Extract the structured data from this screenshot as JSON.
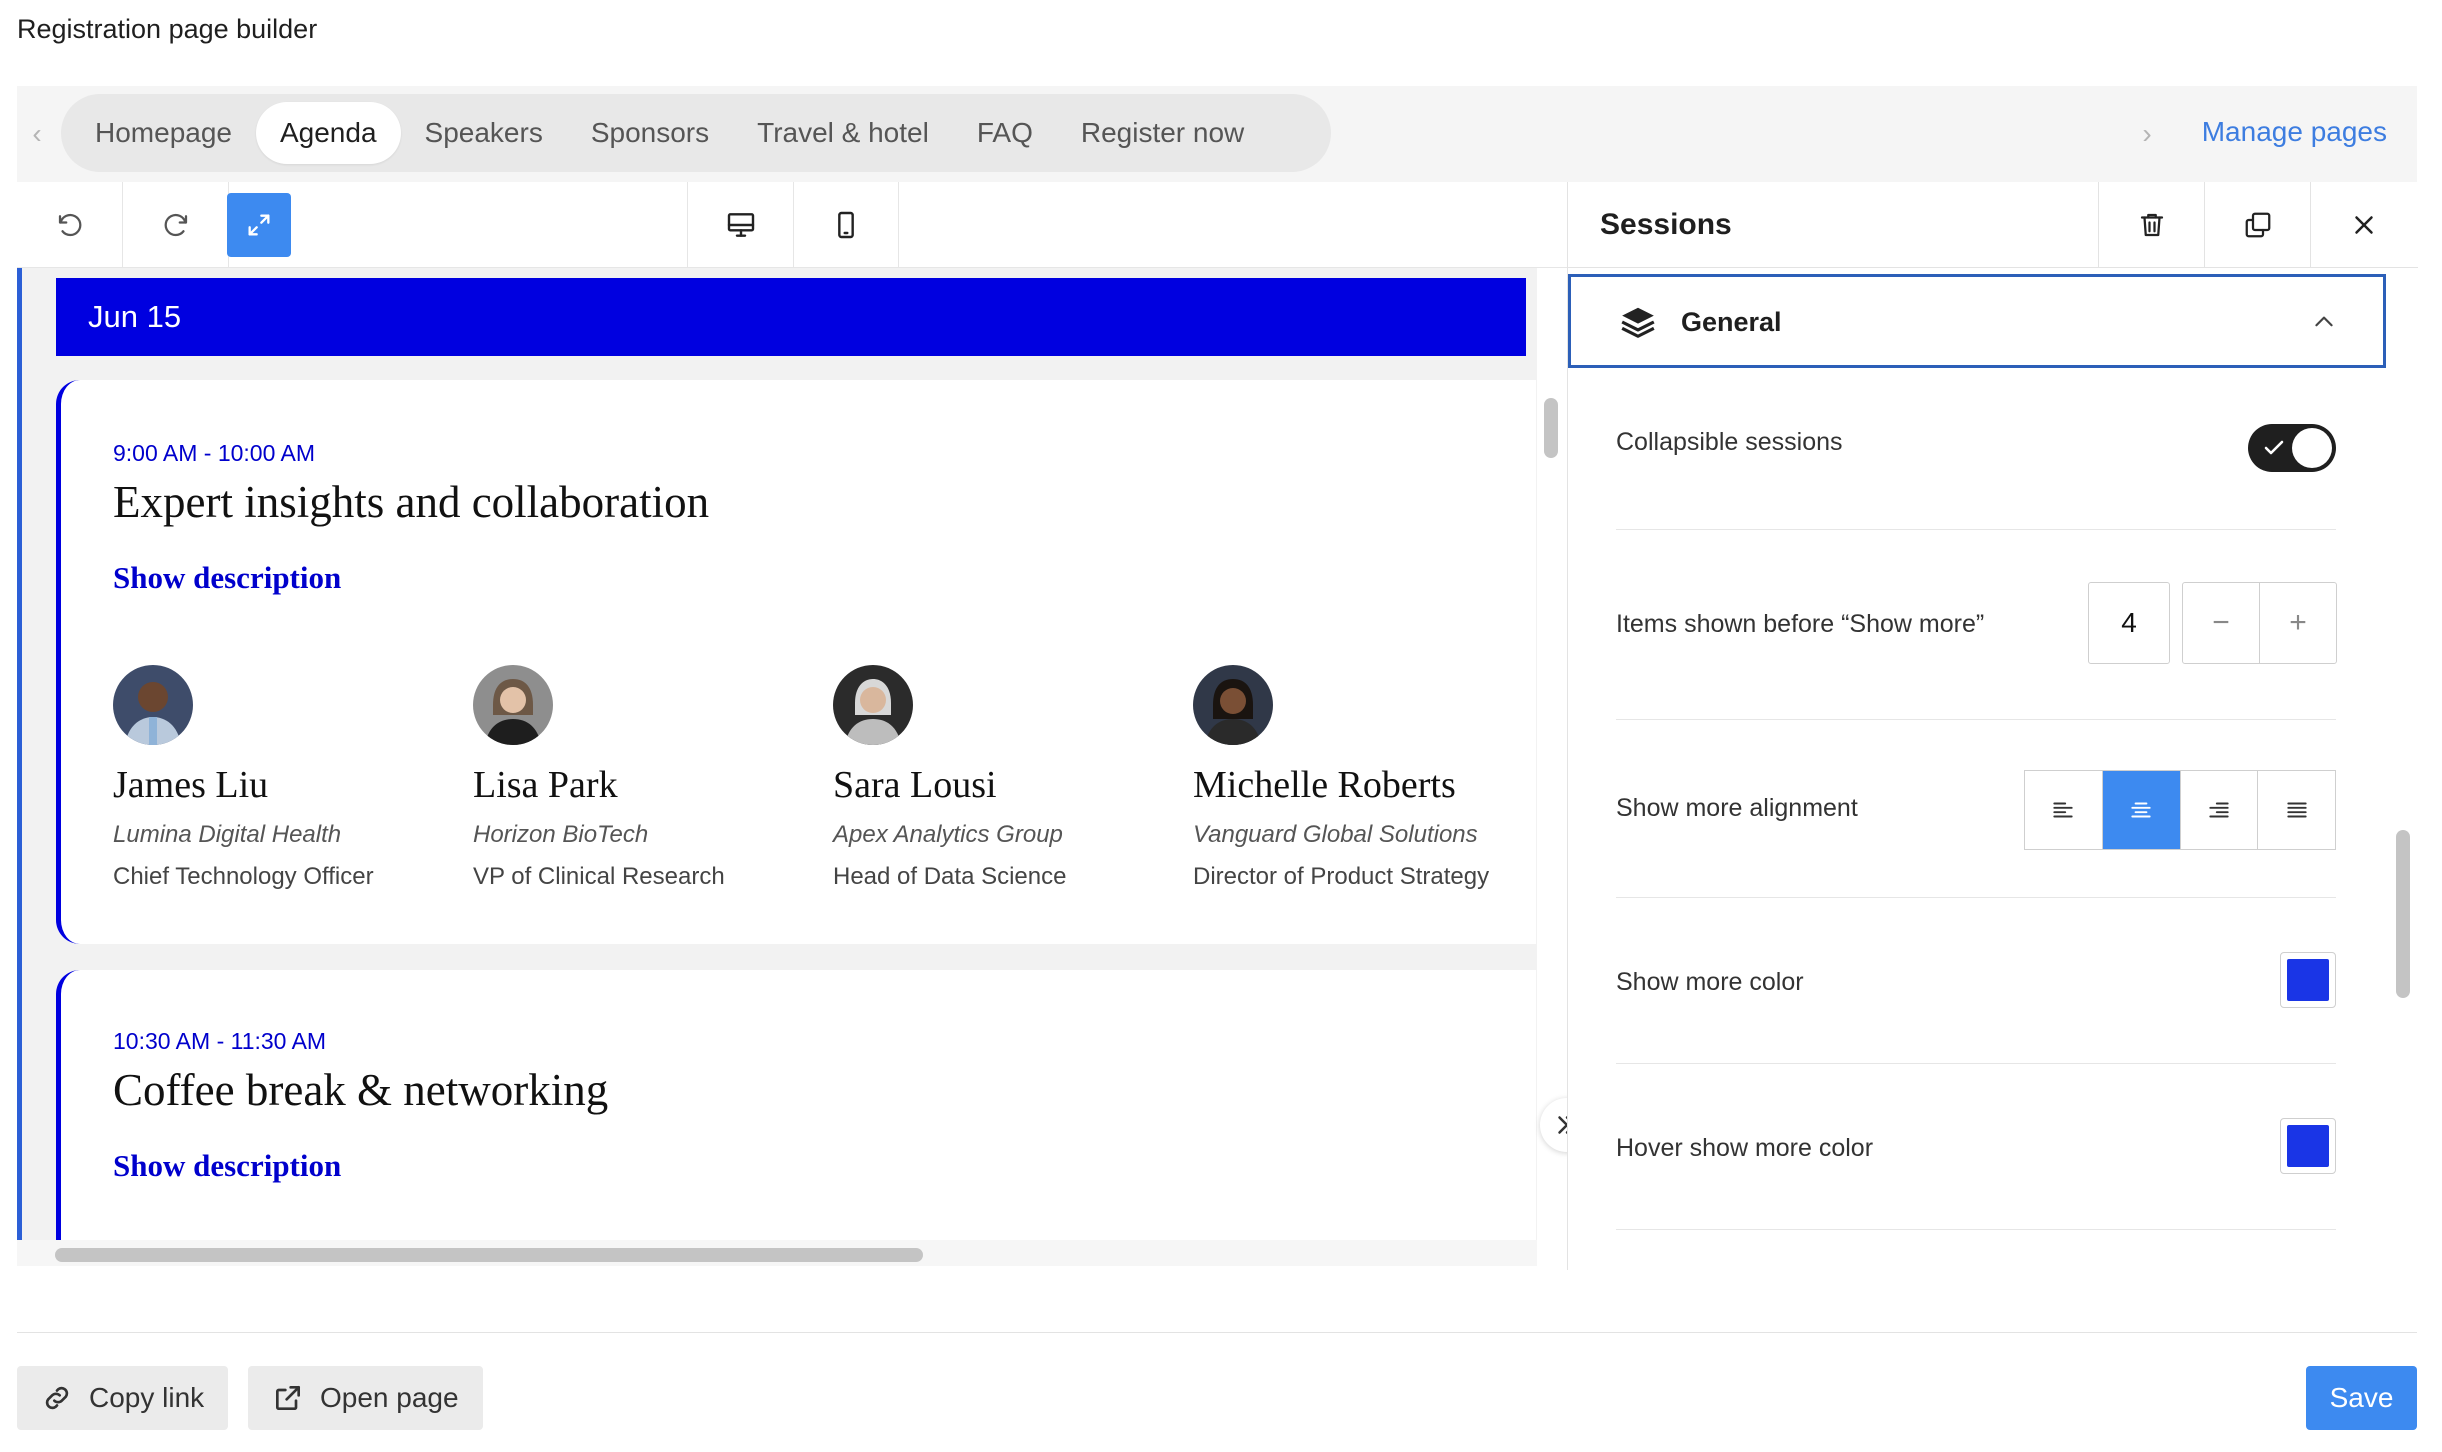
{
  "app": {
    "title": "Registration page builder"
  },
  "pages": {
    "tabs": [
      {
        "label": "Homepage"
      },
      {
        "label": "Agenda"
      },
      {
        "label": "Speakers"
      },
      {
        "label": "Sponsors"
      },
      {
        "label": "Travel & hotel"
      },
      {
        "label": "FAQ"
      },
      {
        "label": "Register now"
      }
    ],
    "active_tab": "Agenda",
    "manage_label": "Manage pages"
  },
  "agenda": {
    "date": "Jun 15",
    "accent_color": "#0000e0",
    "sessions": [
      {
        "time": "9:00 AM - 10:00 AM",
        "title": "Expert insights and collaboration",
        "show_description": "Show description",
        "speakers": [
          {
            "name": "James Liu",
            "company": "Lumina Digital Health",
            "role": "Chief Technology Officer"
          },
          {
            "name": "Lisa Park",
            "company": "Horizon BioTech",
            "role": "VP of Clinical Research"
          },
          {
            "name": "Sara Lousi",
            "company": "Apex Analytics Group",
            "role": "Head of Data Science"
          },
          {
            "name": "Michelle Roberts",
            "company": "Vanguard Global Solutions",
            "role": "Director of Product Strategy"
          }
        ]
      },
      {
        "time": "10:30 AM - 11:30 AM",
        "title": "Coffee break & networking",
        "show_description": "Show description"
      }
    ]
  },
  "panel": {
    "title": "Sessions",
    "section_label": "General",
    "settings": {
      "collapsible_label": "Collapsible sessions",
      "collapsible_on": true,
      "items_label": "Items shown before “Show more”",
      "items_value": "4",
      "alignment_label": "Show more alignment",
      "alignment_selected": "center",
      "color_label": "Show more color",
      "color_value": "#1a35e6",
      "hover_color_label": "Hover show more color",
      "hover_color_value": "#1a35e6"
    }
  },
  "footer": {
    "copy_link": "Copy link",
    "open_page": "Open page",
    "save": "Save"
  }
}
